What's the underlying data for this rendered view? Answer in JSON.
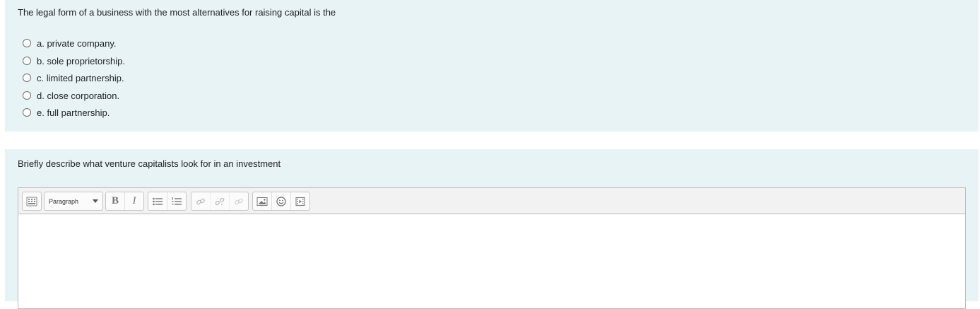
{
  "question1": {
    "text": "The legal form of a business with the most alternatives for raising capital is the",
    "answers": [
      {
        "label": "a. private company."
      },
      {
        "label": "b. sole proprietorship."
      },
      {
        "label": "c. limited partnership."
      },
      {
        "label": "d. close corporation."
      },
      {
        "label": "e. full partnership."
      }
    ]
  },
  "question2": {
    "text": "Briefly describe what venture capitalists look for in an investment",
    "editor": {
      "format_select_value": "Paragraph",
      "toolbar_icons": [
        "toolbar-toggle-icon",
        "bold-icon",
        "italic-icon",
        "unordered-list-icon",
        "ordered-list-icon",
        "link-icon",
        "unlink-icon",
        "autolink-icon",
        "image-icon",
        "emoji-icon",
        "media-icon"
      ],
      "body_text": ""
    }
  }
}
